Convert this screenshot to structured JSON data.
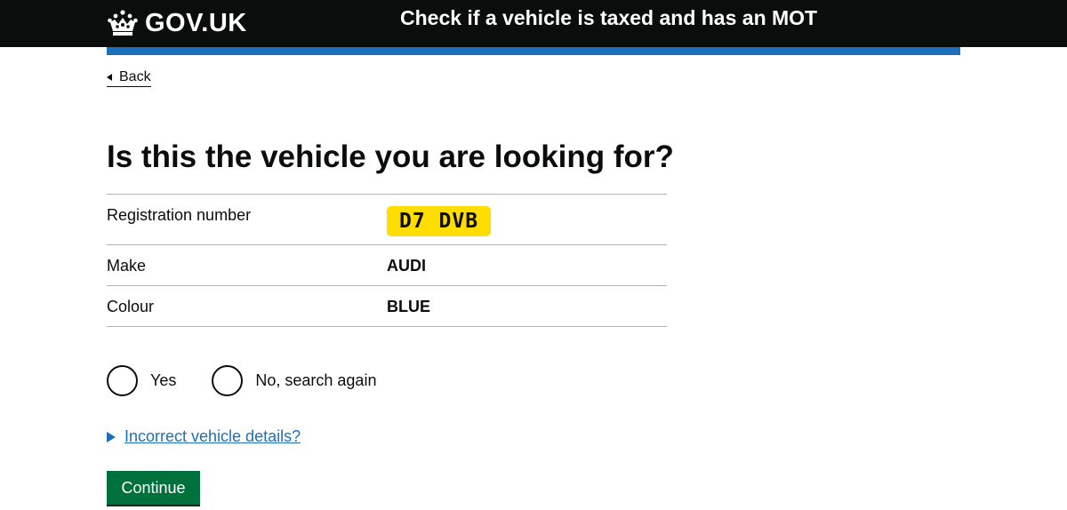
{
  "header": {
    "logo_text": "GOV.UK",
    "service_name": "Check if a vehicle is taxed and has an MOT"
  },
  "back_link": {
    "label": "Back"
  },
  "page_title": "Is this the vehicle you are looking for?",
  "vehicle": [
    {
      "key": "Registration number",
      "value": "D7 DVB"
    },
    {
      "key": "Make",
      "value": "AUDI"
    },
    {
      "key": "Colour",
      "value": "BLUE"
    }
  ],
  "radios": [
    {
      "label": "Yes"
    },
    {
      "label": "No, search again"
    }
  ],
  "details": {
    "summary": "Incorrect vehicle details?"
  },
  "continue_button": {
    "label": "Continue"
  },
  "colors": {
    "header_bg": "#0b0c0c",
    "brand_blue": "#1d70b8",
    "plate_yellow": "#ffdd00",
    "button_green": "#00703c"
  },
  "icons": [
    "crown-icon",
    "back-chevron-icon",
    "details-triangle-icon"
  ]
}
